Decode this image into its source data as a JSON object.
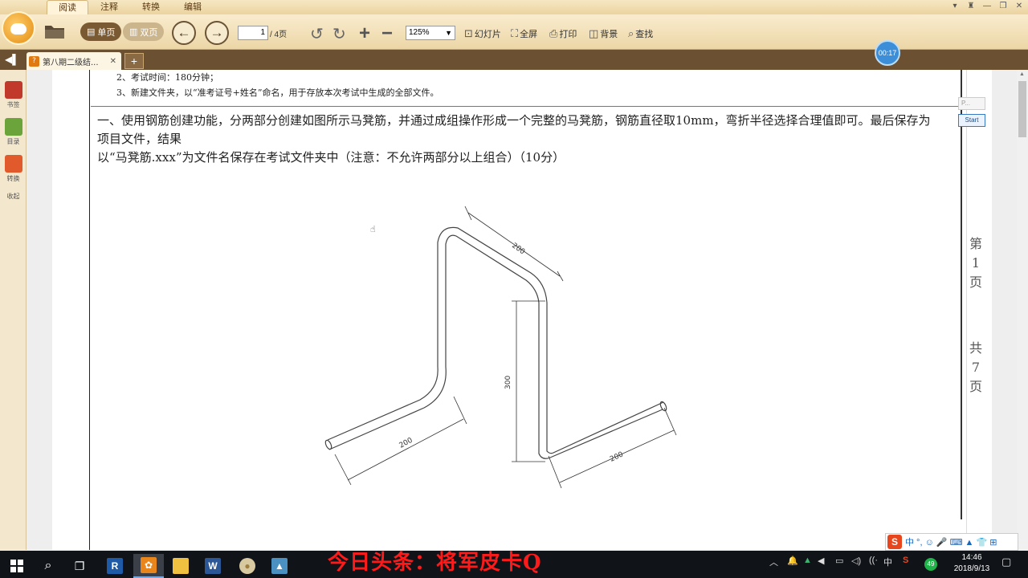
{
  "menu": {
    "tabs": [
      "阅读",
      "注释",
      "转换",
      "编辑"
    ],
    "window_controls": [
      "▾",
      "♜",
      "—",
      "❐",
      "✕"
    ]
  },
  "toolbar": {
    "single_page": "单页",
    "double_page": "双页",
    "page_current": "1",
    "page_total": "/ 4页",
    "zoom": "125%",
    "slideshow": "幻灯片",
    "fullscreen": "全屏",
    "print": "打印",
    "background": "背景",
    "search": "查找"
  },
  "tabs": {
    "doc_title": "第八期二级结...",
    "add": "+"
  },
  "timer": "00:17",
  "sidebar": {
    "items": [
      {
        "label": "书签",
        "icon": "bookmark-icon",
        "color": "#c0392b"
      },
      {
        "label": "目录",
        "icon": "toc-icon",
        "color": "#6aa43a"
      },
      {
        "label": "转换",
        "icon": "convert-icon",
        "color": "#e05a2b"
      },
      {
        "label": "收起",
        "icon": "collapse-icon",
        "color": "#888888"
      }
    ]
  },
  "document": {
    "rule2": "2、考试时间：180分钟；",
    "rule3": "3、新建文件夹，以“准考证号+姓名”命名，用于存放本次考试中生成的全部文件。",
    "question_line1": "一、使用钢筋创建功能，分两部分创建如图所示马凳筋，并通过成组操作形成一个完整的马凳筋，钢筋直径取10mm，弯折半径选择合理值即可。最后保存为项目文件，结果",
    "question_line2": "以“马凳筋.xxx”为文件名保存在考试文件夹中（注意：不允许两部分以上组合）（10分）",
    "dims": [
      "200",
      "300",
      "200",
      "200"
    ],
    "side_page": [
      "第",
      "1",
      "页"
    ],
    "side_total": [
      "共",
      "7",
      "页"
    ],
    "mini_panel": "P...",
    "start_button": "Start"
  },
  "ime": {
    "logo": "S",
    "text": "中 °, ☺ 🎤 ⌨ ▲ 👕 ⊞"
  },
  "taskbar": {
    "apps": [
      {
        "name": "revit",
        "label": "R",
        "color": "#1f5aa6"
      },
      {
        "name": "reader",
        "label": "✿",
        "color": "#e8861b"
      },
      {
        "name": "explorer",
        "label": "",
        "color": "#f0c040"
      },
      {
        "name": "word",
        "label": "W",
        "color": "#2b5797"
      },
      {
        "name": "app5",
        "label": "●",
        "color": "#d8c9a0"
      },
      {
        "name": "app6",
        "label": "▲",
        "color": "#4a90c0"
      }
    ],
    "watermark": "今日头条：将军皮卡Q",
    "tray_lang": "中",
    "badge": "49",
    "time": "14:46",
    "date": "2018/9/13"
  }
}
